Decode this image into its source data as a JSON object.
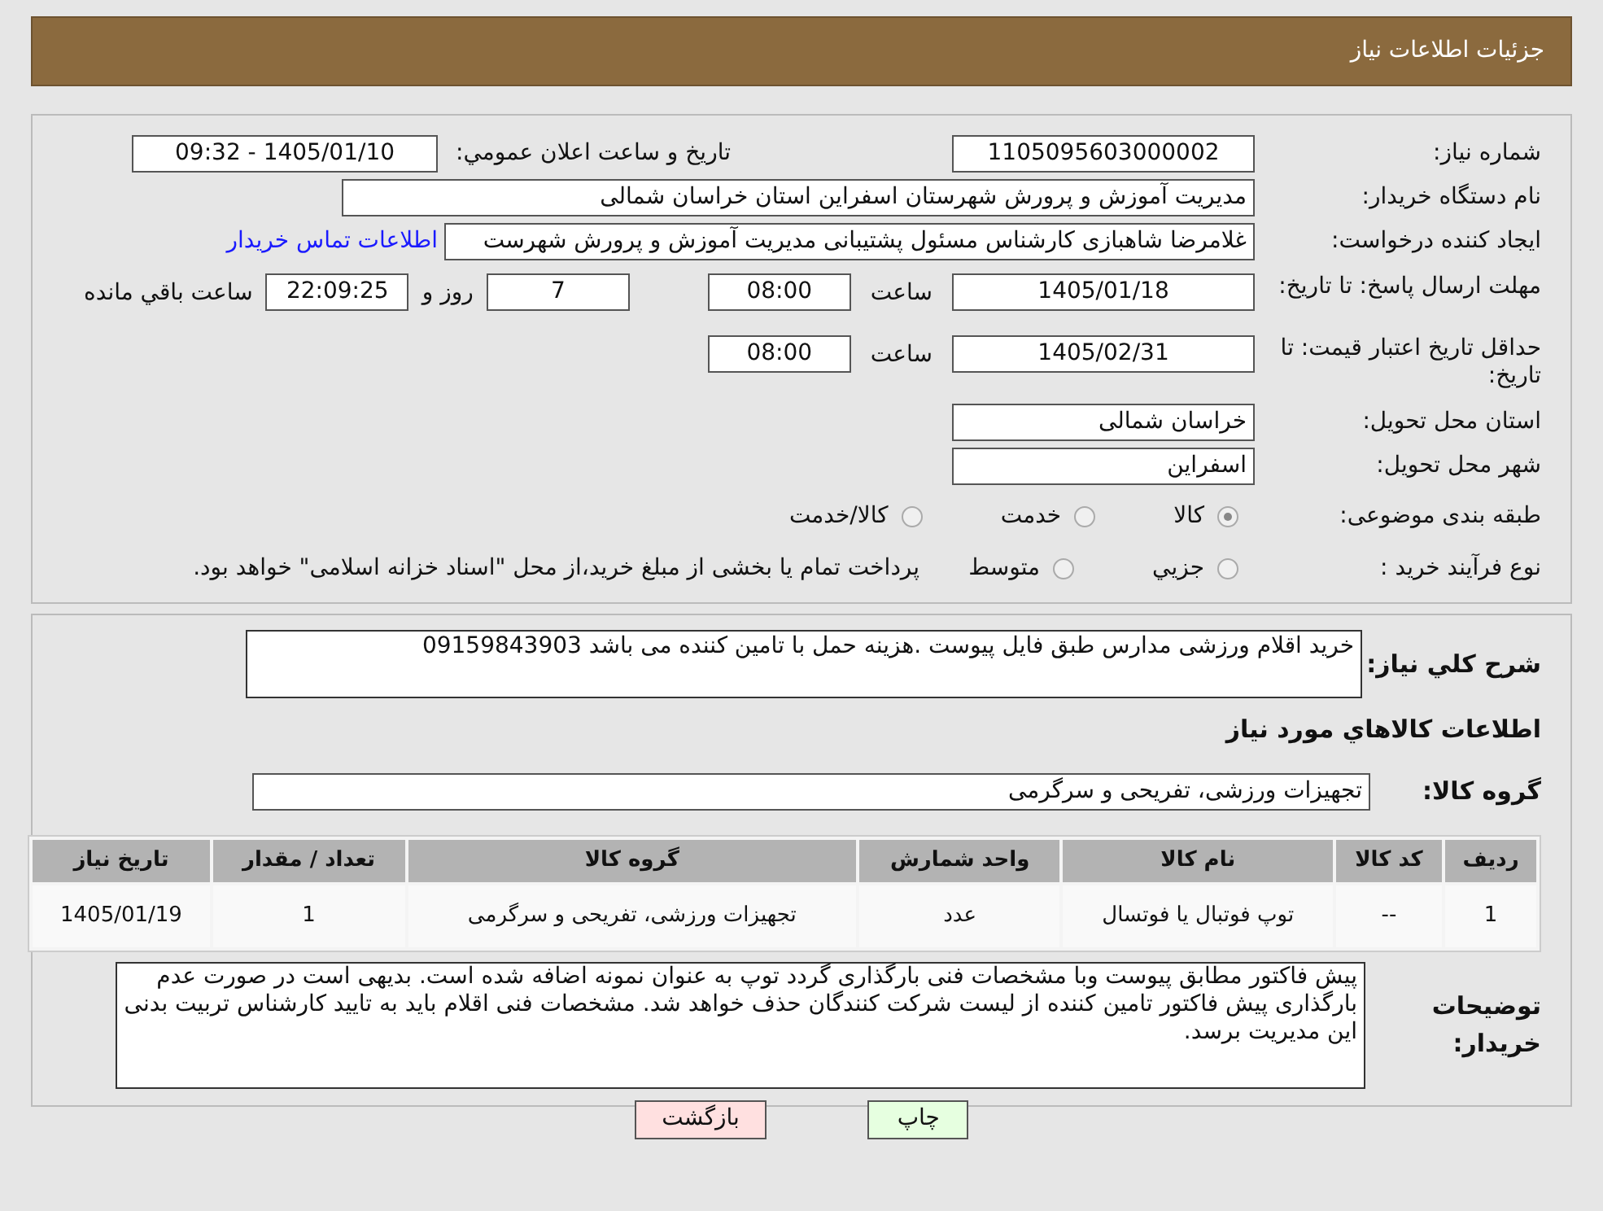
{
  "header": {
    "title": "جزئیات اطلاعات نیاز"
  },
  "need_number": {
    "label": "شماره نیاز:",
    "value": "1105095603000002"
  },
  "announce": {
    "label": "تاریخ و ساعت اعلان عمومي:",
    "value": "1405/01/10 - 09:32"
  },
  "buyer_org": {
    "label": "نام دستگاه خریدار:",
    "value": "مدیریت آموزش و پرورش شهرستان اسفراین استان خراسان شمالی"
  },
  "requester": {
    "label": "ایجاد کننده درخواست:",
    "value": "غلامرضا شاهبازی کارشناس مسئول پشتیبانی مدیریت آموزش و پرورش شهرست",
    "link": "اطلاعات تماس خریدار"
  },
  "deadline": {
    "label": "مهلت ارسال پاسخ: تا تاریخ:",
    "date": "1405/01/18",
    "time_label": "ساعت",
    "time": "08:00",
    "days": "7",
    "days_suffix": "روز و",
    "remaining": "22:09:25",
    "remaining_suffix": "ساعت باقي مانده"
  },
  "validity": {
    "label": "حداقل تاریخ اعتبار قیمت: تا تاریخ:",
    "date": "1405/02/31",
    "time_label": "ساعت",
    "time": "08:00"
  },
  "province": {
    "label": "استان محل تحویل:",
    "value": "خراسان شمالی"
  },
  "city": {
    "label": "شهر محل تحویل:",
    "value": "اسفراین"
  },
  "category": {
    "label": "طبقه بندی موضوعی:",
    "options": [
      {
        "label": "کالا",
        "selected": true
      },
      {
        "label": "خدمت",
        "selected": false
      },
      {
        "label": "کالا/خدمت",
        "selected": false
      }
    ]
  },
  "process": {
    "label": "نوع فرآیند خرید :",
    "options": [
      {
        "label": "جزيي",
        "selected": false
      },
      {
        "label": "متوسط",
        "selected": false
      }
    ],
    "note": "پرداخت تمام یا بخشی از مبلغ خرید،از محل \"اسناد خزانه اسلامی\" خواهد بود."
  },
  "description": {
    "label": "شرح کلي نیاز:",
    "value": "خرید اقلام ورزشی مدارس طبق فایل پیوست .هزینه حمل با تامین کننده می باشد 09159843903"
  },
  "goods_title": "اطلاعات کالاهاي مورد نیاز",
  "goods_group": {
    "label": "گروه کالا:",
    "value": "تجهیزات ورزشی، تفریحی و سرگرمی"
  },
  "table": {
    "columns": [
      "ردیف",
      "کد کالا",
      "نام کالا",
      "واحد شمارش",
      "گروه کالا",
      "تعداد / مقدار",
      "تاریخ نیاز"
    ],
    "rows": [
      [
        "1",
        "--",
        "توپ فوتبال یا فوتسال",
        "عدد",
        "تجهیزات ورزشی، تفریحی و سرگرمی",
        "1",
        "1405/01/19"
      ]
    ]
  },
  "buyer_notes": {
    "label": "توضیحات خریدار:",
    "value": "پیش فاکتور مطابق پیوست وبا مشخصات فنی بارگذاری گردد توپ به عنوان نمونه اضافه شده است. بدیهی است در صورت عدم بارگذاری پیش فاکتور تامین کننده از لیست شرکت کنندگان حذف خواهد شد. مشخصات فنی اقلام باید به تایید کارشناس تربیت بدنی این مدیریت برسد."
  },
  "buttons": [
    {
      "label": "چاپ",
      "kind": "print"
    },
    {
      "label": "بازگشت",
      "kind": "back"
    }
  ]
}
